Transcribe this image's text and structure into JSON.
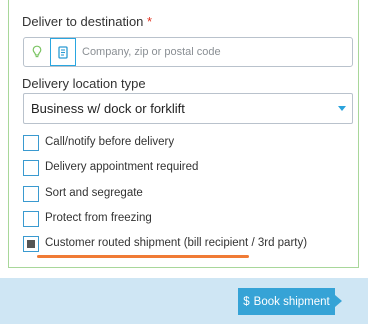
{
  "destination": {
    "label": "Deliver to destination",
    "required_mark": "*",
    "input_value": "",
    "placeholder": "Company, zip or postal code"
  },
  "location_type": {
    "label": "Delivery location type",
    "selected": "Business w/ dock or forklift"
  },
  "options": [
    {
      "label": "Call/notify before delivery",
      "checked": false
    },
    {
      "label": "Delivery appointment required",
      "checked": false
    },
    {
      "label": "Sort and segregate",
      "checked": false
    },
    {
      "label": "Protect from freezing",
      "checked": false
    },
    {
      "label": "Customer routed shipment (bill recipient / 3rd party)",
      "checked": true
    }
  ],
  "footer": {
    "book_label": "Book shipment",
    "book_icon": "$"
  },
  "colors": {
    "panel_border": "#a8d79a",
    "accent": "#36a3d6",
    "footer_bg": "#cfe6f4",
    "highlight": "#f07b35",
    "required": "#e0311f"
  }
}
